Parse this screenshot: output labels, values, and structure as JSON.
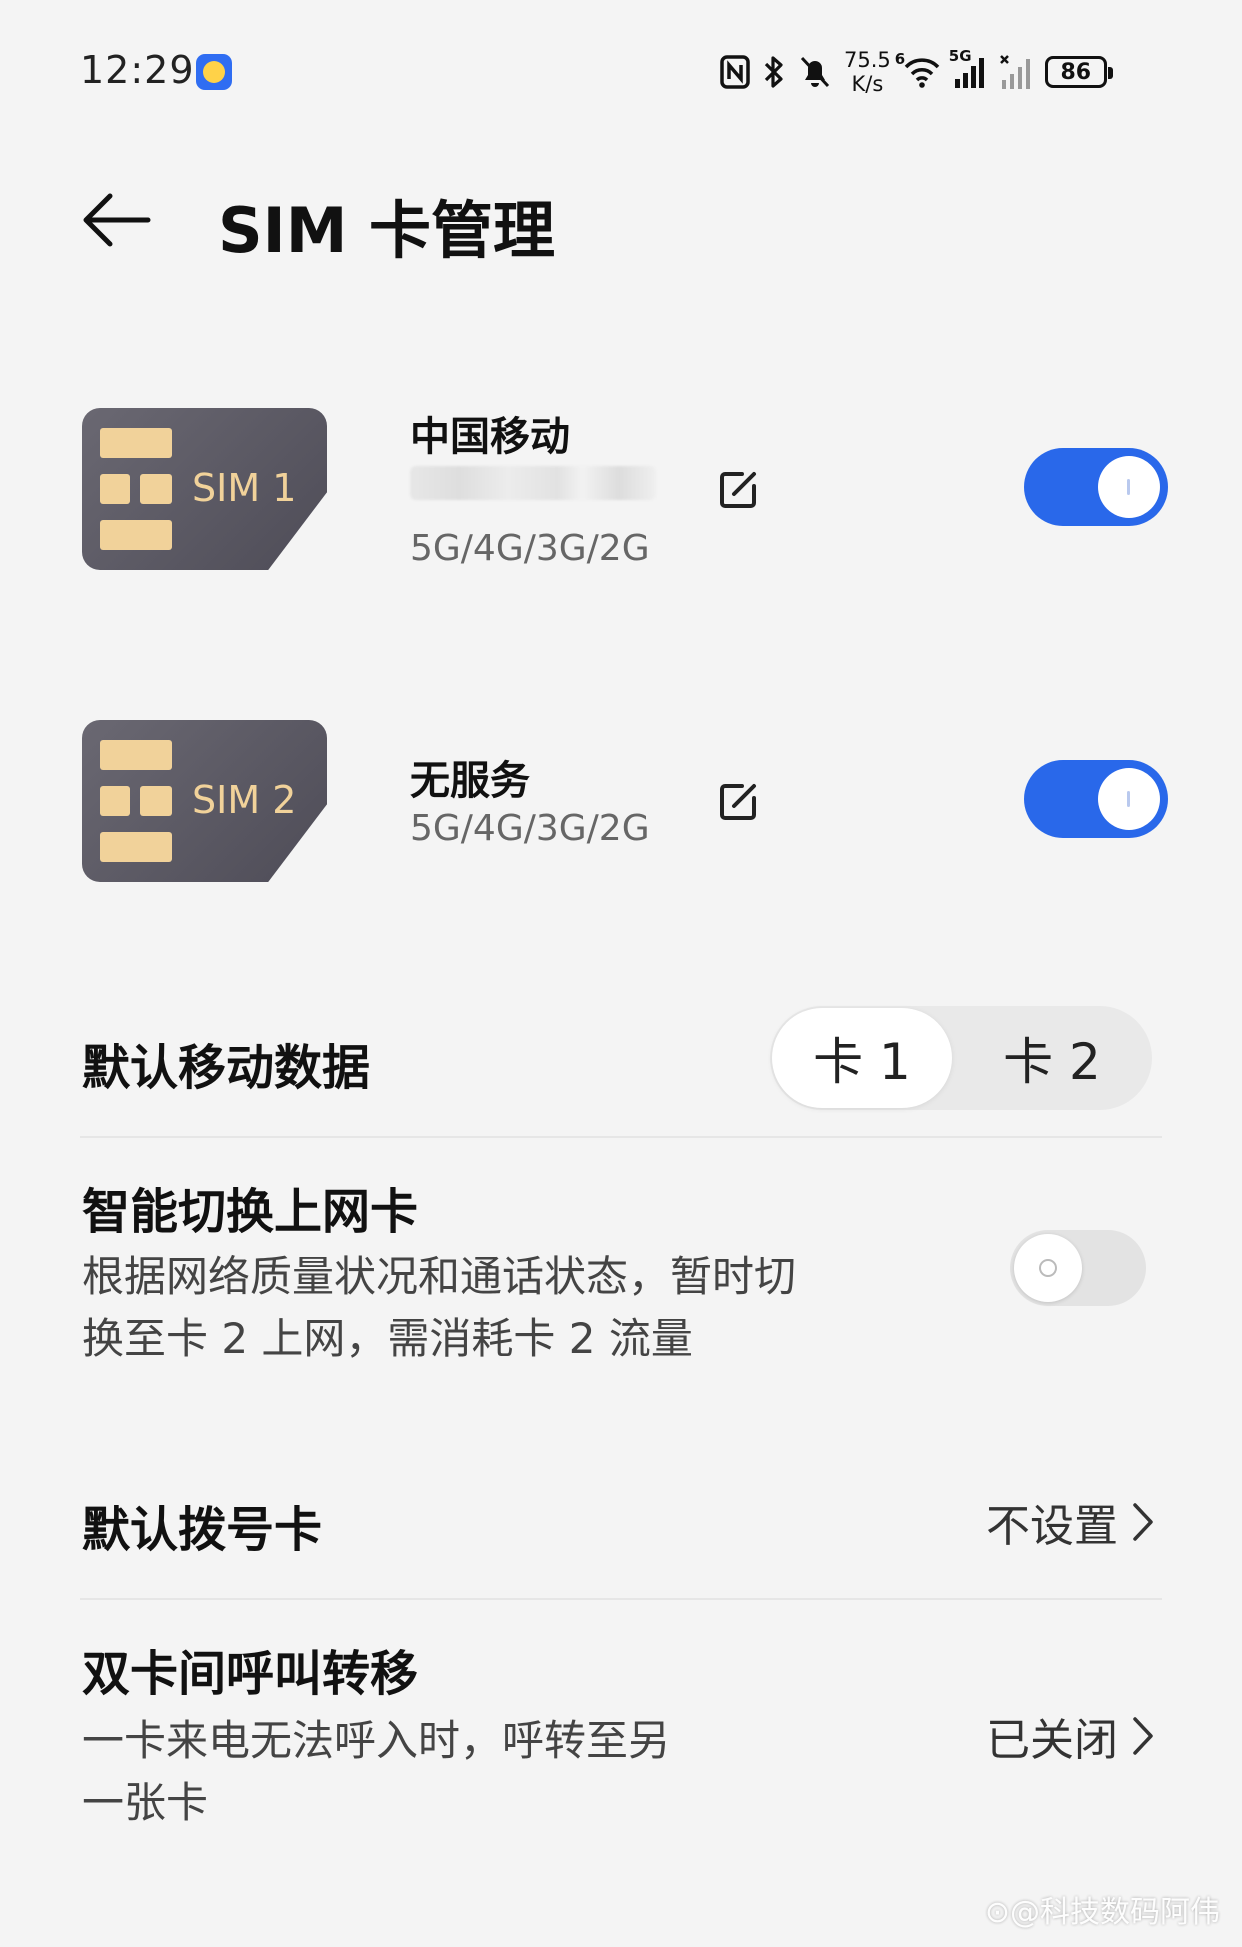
{
  "status_bar": {
    "time": "12:29",
    "net_speed_value": "75.5",
    "net_speed_unit": "K/s",
    "wifi_badge": "6",
    "signal_badge": "5G",
    "battery": "86"
  },
  "header": {
    "title": "SIM 卡管理"
  },
  "sims": [
    {
      "card_label": "SIM 1",
      "carrier": "中国移动",
      "bands": "5G/4G/3G/2G",
      "enabled": true
    },
    {
      "card_label": "SIM 2",
      "carrier": "无服务",
      "bands": "5G/4G/3G/2G",
      "enabled": true
    }
  ],
  "default_data": {
    "title": "默认移动数据",
    "options": [
      "卡 1",
      "卡 2"
    ],
    "selected": "卡 1"
  },
  "smart_switch": {
    "title": "智能切换上网卡",
    "desc_line1": "根据网络质量状况和通话状态，暂时切",
    "desc_line2": "换至卡 2 上网，需消耗卡 2 流量",
    "enabled": false
  },
  "default_dial": {
    "title": "默认拨号卡",
    "value": "不设置"
  },
  "call_forward": {
    "title": "双卡间呼叫转移",
    "desc_line1": "一卡来电无法呼入时，呼转至另",
    "desc_line2": "一张卡",
    "value": "已关闭"
  },
  "watermark": "⊙@科技数码阿伟",
  "colors": {
    "accent": "#2968ea",
    "sim_gold": "#f1d29a",
    "sim_body": "#5a5862"
  }
}
